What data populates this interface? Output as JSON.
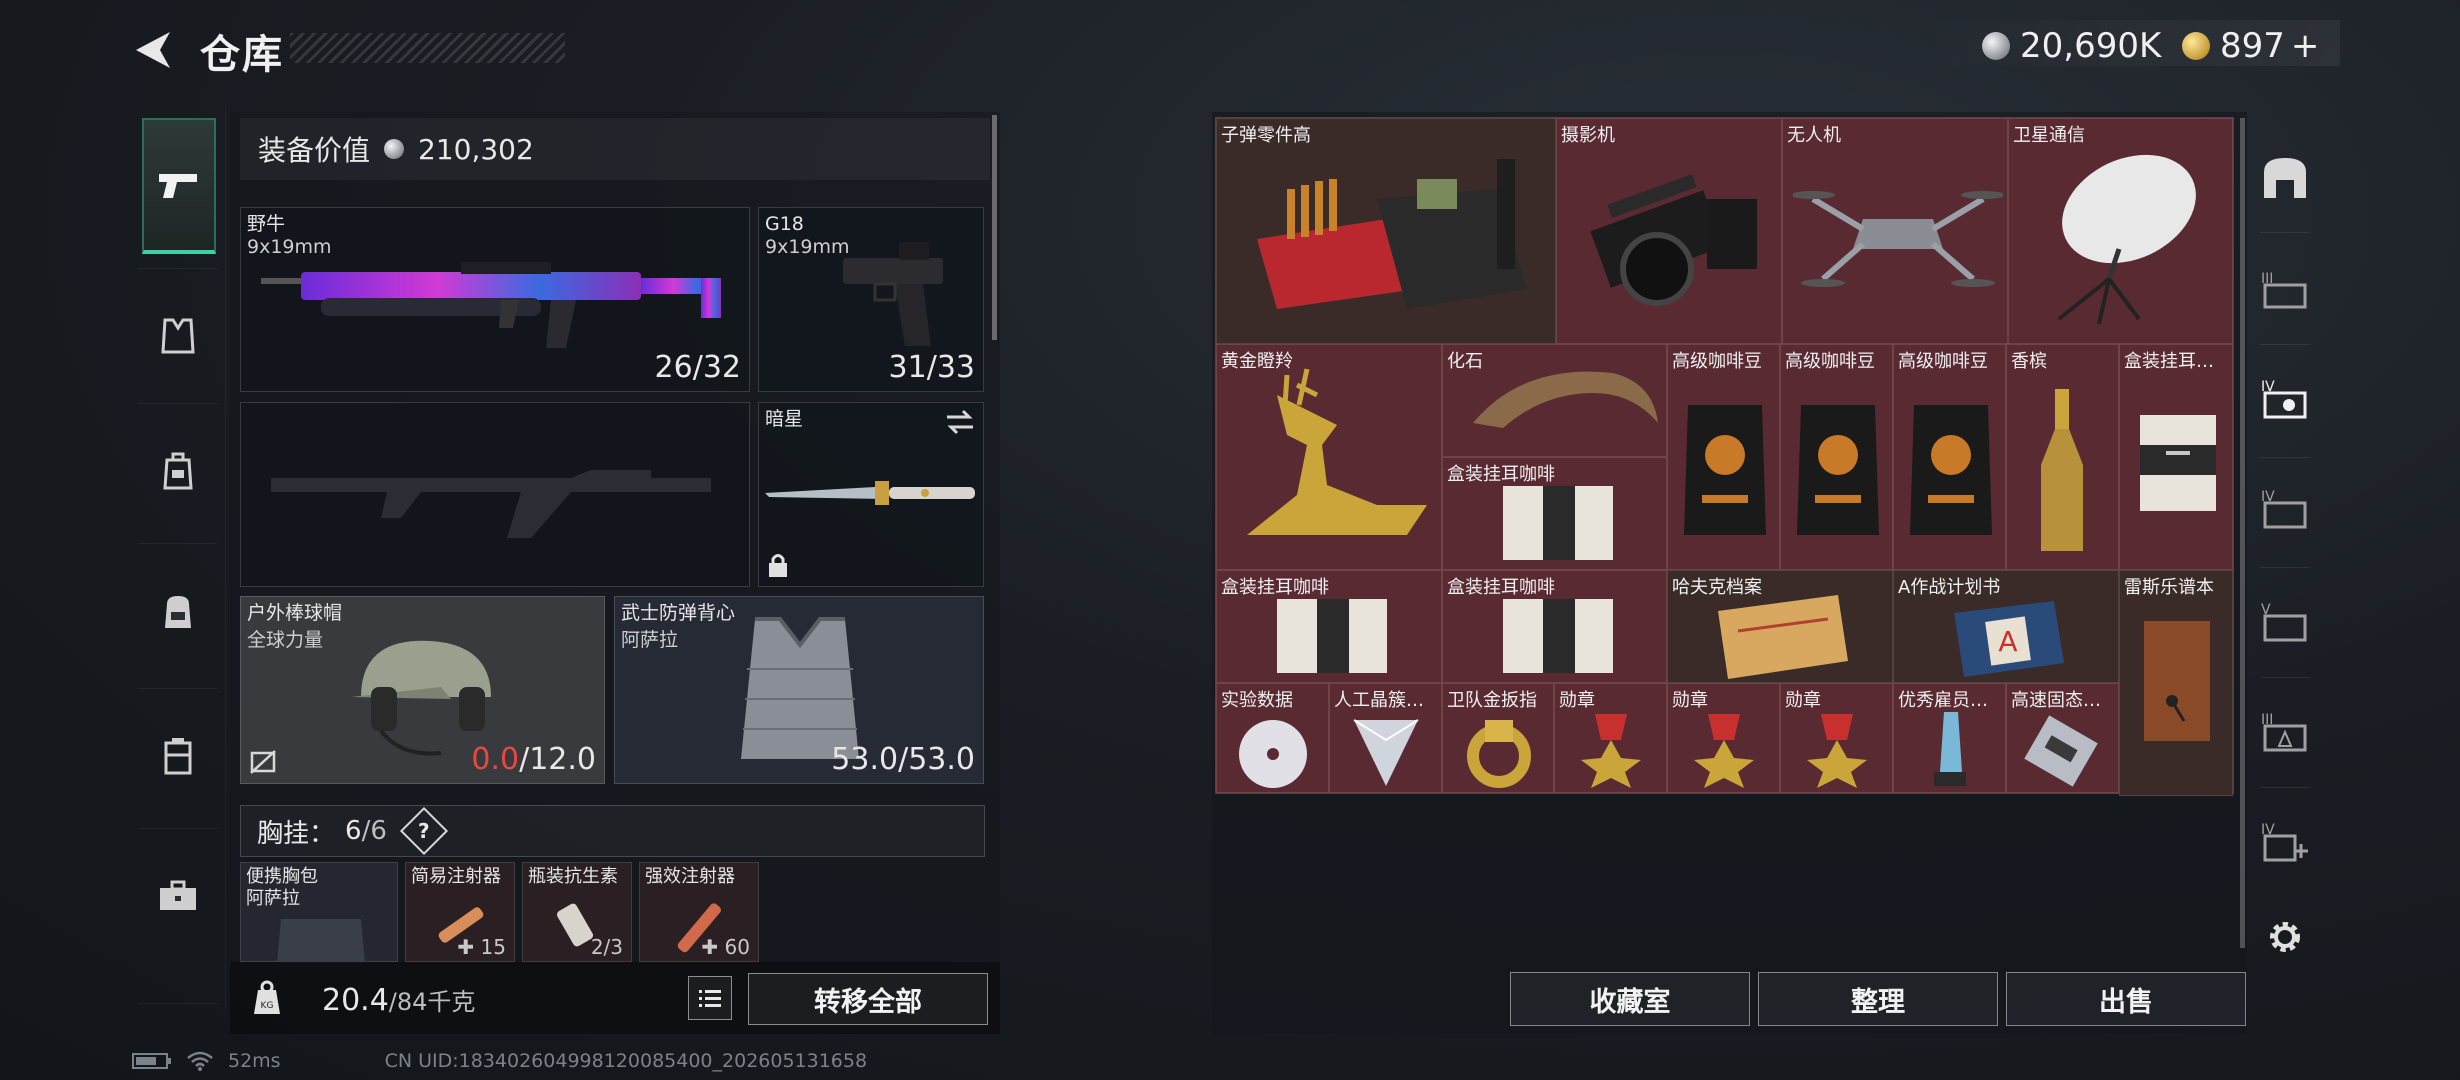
{
  "header": {
    "title": "仓库",
    "currency_silver": "20,690K",
    "currency_gold": "897",
    "currency_gold_plus": "+"
  },
  "equipment": {
    "value_label": "装备价值",
    "value": "210,302",
    "primary": {
      "name": "野牛",
      "caliber": "9x19mm",
      "ammo": "26/32"
    },
    "secondary": {
      "name": "G18",
      "caliber": "9x19mm",
      "ammo": "31/33"
    },
    "melee": {
      "name": "暗星"
    },
    "helmet": {
      "name": "户外棒球帽",
      "brand": "全球力量",
      "durability": "0.0",
      "durability_max": "/12.0"
    },
    "armor": {
      "name": "武士防弹背心",
      "brand": "阿萨拉",
      "durability": "53.0/53.0"
    },
    "chest": {
      "label": "胸挂：",
      "count": "6",
      "capacity": "/6",
      "help": "?"
    },
    "pouches": [
      {
        "name": "便携胸包",
        "brand": "阿萨拉",
        "count": ""
      },
      {
        "name": "简易注射器",
        "count": "15"
      },
      {
        "name": "瓶装抗生素",
        "count": "2/3"
      },
      {
        "name": "强效注射器",
        "count": "60"
      }
    ],
    "weight": "20.4",
    "weight_max": "/84千克",
    "transfer_all": "转移全部"
  },
  "stash": {
    "items": [
      {
        "id": "ammo_parts",
        "label": "子弹零件高"
      },
      {
        "id": "camera",
        "label": "摄影机"
      },
      {
        "id": "drone",
        "label": "无人机"
      },
      {
        "id": "satcom",
        "label": "卫星通信"
      },
      {
        "id": "gold_deer",
        "label": "黄金瞪羚"
      },
      {
        "id": "fossil",
        "label": "化石"
      },
      {
        "id": "coffee1",
        "label": "高级咖啡豆"
      },
      {
        "id": "coffee2",
        "label": "高级咖啡豆"
      },
      {
        "id": "coffee3",
        "label": "高级咖啡豆"
      },
      {
        "id": "champagne",
        "label": "香槟"
      },
      {
        "id": "box1",
        "label": "盒装挂耳…"
      },
      {
        "id": "box2",
        "label": "盒装挂耳咖啡"
      },
      {
        "id": "box3",
        "label": "盒装挂耳咖啡"
      },
      {
        "id": "box4",
        "label": "盒装挂耳咖啡"
      },
      {
        "id": "archive",
        "label": "哈夫克档案"
      },
      {
        "id": "planA",
        "label": "A作战计划书"
      },
      {
        "id": "notebook",
        "label": "雷斯乐谱本"
      },
      {
        "id": "labdata",
        "label": "实验数据"
      },
      {
        "id": "crystal",
        "label": "人工晶簇…"
      },
      {
        "id": "ring",
        "label": "卫队金扳指"
      },
      {
        "id": "medal1",
        "label": "勋章"
      },
      {
        "id": "medal2",
        "label": "勋章"
      },
      {
        "id": "medal3",
        "label": "勋章"
      },
      {
        "id": "trophy",
        "label": "优秀雇员…"
      },
      {
        "id": "ssd",
        "label": "高速固态…"
      }
    ],
    "buttons": {
      "collection": "收藏室",
      "sort": "整理",
      "sell": "出售"
    }
  },
  "status": {
    "ping": "52ms",
    "uid": "CN UID:1834026049981200854​00_202605131658"
  },
  "colors": {
    "stash_bg": "#5a2a32",
    "active_tab": "#3fd0a8",
    "durability_zero": "#e8483f"
  }
}
